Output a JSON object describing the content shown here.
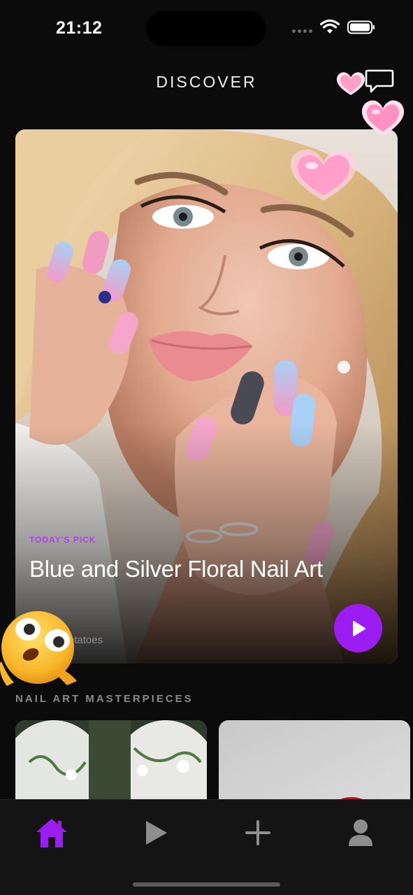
{
  "status_bar": {
    "time": "21:12"
  },
  "header": {
    "title": "DISCOVER"
  },
  "hero": {
    "tag": "TODAY'S PICK",
    "title": "Blue and Silver Floral Nail Art",
    "author": "Sweet Potatoes"
  },
  "section": {
    "title": "NAIL ART MASTERPIECES"
  },
  "icons": {
    "home": "home-icon",
    "play": "play-icon",
    "add": "plus-icon",
    "profile": "person-icon",
    "chat": "chat-bubble-icon"
  },
  "colors": {
    "accent": "#9c1df2",
    "tag": "#b23cf0",
    "background": "#0b0b0c",
    "tab_bar": "#141414"
  }
}
